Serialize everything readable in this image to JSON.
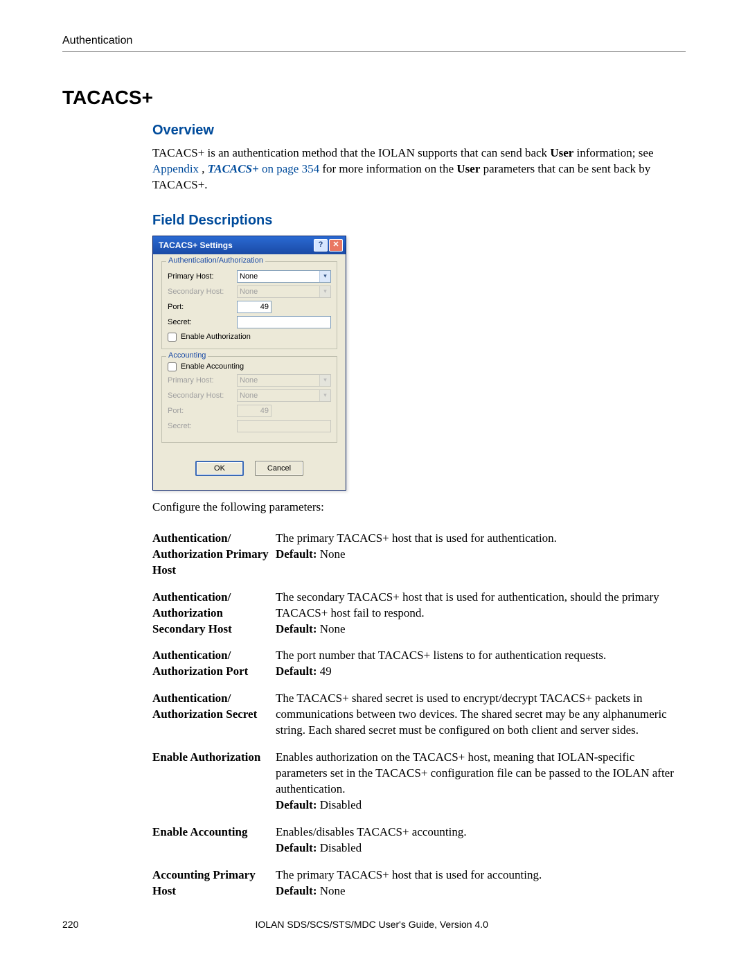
{
  "header": {
    "breadcrumb": "Authentication"
  },
  "title": "TACACS+",
  "sub_overview": "Overview",
  "overview": {
    "pre": "TACACS+ is an authentication method that the IOLAN supports that can send back ",
    "bold1": "User",
    "mid": " information; see ",
    "link1": "Appendix ",
    "link1_sep": ", ",
    "link2": "TACACS+",
    "link2_after": " on page 354",
    "post1": " for more information on the ",
    "bold2": "User",
    "post2": " parameters that can be sent back by TACACS+."
  },
  "sub_field": "Field Descriptions",
  "dialog": {
    "title": "TACACS+ Settings",
    "help_icon": "?",
    "close_icon": "✕",
    "group_auth": "Authentication/Authorization",
    "group_acct": "Accounting",
    "labels": {
      "primary": "Primary Host:",
      "secondary": "Secondary Host:",
      "port": "Port:",
      "secret": "Secret:",
      "enable_authz": "Enable Authorization",
      "enable_acct": "Enable Accounting"
    },
    "values": {
      "primary_auth": "None",
      "secondary_auth": "None",
      "port_auth": "49",
      "secret_auth": "",
      "primary_acct": "None",
      "secondary_acct": "None",
      "port_acct": "49",
      "secret_acct": ""
    },
    "buttons": {
      "ok": "OK",
      "cancel": "Cancel"
    }
  },
  "configure_line": "Configure the following parameters:",
  "fields": [
    {
      "term": "Authentication/\nAuthorization Primary Host",
      "desc": "The primary TACACS+ host that is used for authentication.",
      "default_label": "Default:",
      "default": " None"
    },
    {
      "term": "Authentication/\nAuthorization Secondary Host",
      "desc": "The secondary TACACS+ host that is used for authentication, should the primary TACACS+ host fail to respond.",
      "default_label": "Default:",
      "default": " None"
    },
    {
      "term": "Authentication/\nAuthorization Port",
      "desc": "The port number that TACACS+ listens to for authentication requests.",
      "default_label": "Default:",
      "default": " 49"
    },
    {
      "term": "Authentication/\nAuthorization Secret",
      "desc": "The TACACS+ shared secret is used to encrypt/decrypt TACACS+ packets in communications between two devices. The shared secret may be any alphanumeric string. Each shared secret must be configured on both client and server sides.",
      "default_label": "",
      "default": ""
    },
    {
      "term": "Enable Authorization",
      "desc": "Enables authorization on the TACACS+ host, meaning that IOLAN-specific parameters set in the TACACS+ configuration file can be passed to the IOLAN after authentication.",
      "default_label": "Default:",
      "default": " Disabled"
    },
    {
      "term": "Enable Accounting",
      "desc": "Enables/disables TACACS+ accounting.",
      "default_label": "Default:",
      "default": " Disabled"
    },
    {
      "term": "Accounting Primary Host",
      "desc": "The primary TACACS+ host that is used for accounting.",
      "default_label": "Default:",
      "default": " None"
    }
  ],
  "footer": {
    "page": "220",
    "guide": "IOLAN SDS/SCS/STS/MDC User's Guide, Version 4.0"
  }
}
